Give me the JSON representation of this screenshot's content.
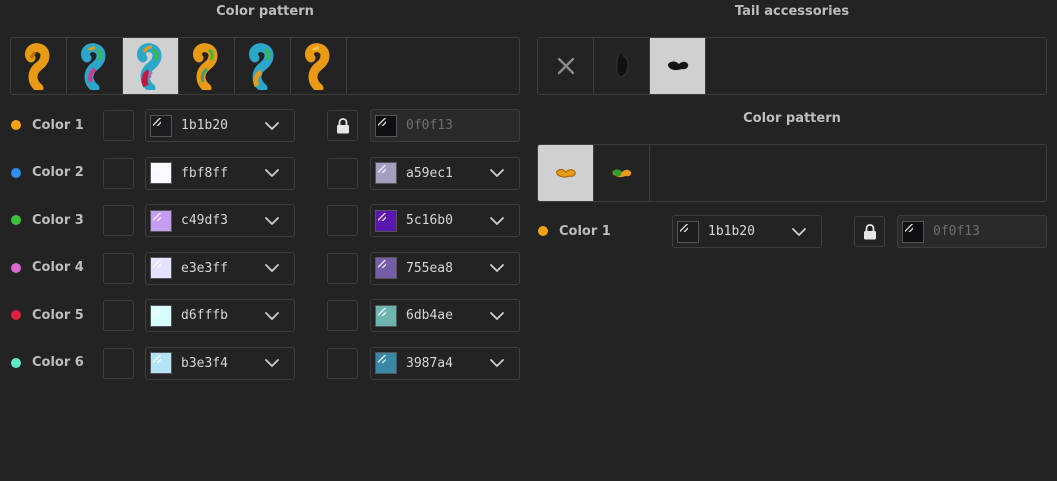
{
  "left": {
    "title": "Color pattern",
    "pattern_thumbs": [
      {
        "name": "tail-pattern-1",
        "selected": false
      },
      {
        "name": "tail-pattern-2",
        "selected": false
      },
      {
        "name": "tail-pattern-3",
        "selected": true
      },
      {
        "name": "tail-pattern-4",
        "selected": false
      },
      {
        "name": "tail-pattern-5",
        "selected": false
      },
      {
        "name": "tail-pattern-6",
        "selected": false
      }
    ],
    "rows": [
      {
        "label": "Color 1",
        "dot": "#f5a30f",
        "primary_hex": "1b1b20",
        "primary_color": "#1b1b20",
        "secondary_hex": "0f0f13",
        "secondary_color": "#0f0f13",
        "locked": true
      },
      {
        "label": "Color 2",
        "dot": "#2f8ff0",
        "primary_hex": "fbf8ff",
        "primary_color": "#fbf8ff",
        "secondary_hex": "a59ec1",
        "secondary_color": "#a59ec1",
        "locked": false
      },
      {
        "label": "Color 3",
        "dot": "#3bc43b",
        "primary_hex": "c49df3",
        "primary_color": "#c49df3",
        "secondary_hex": "5c16b0",
        "secondary_color": "#5c16b0",
        "locked": false
      },
      {
        "label": "Color 4",
        "dot": "#d86ad0",
        "primary_hex": "e3e3ff",
        "primary_color": "#e3e3ff",
        "secondary_hex": "755ea8",
        "secondary_color": "#755ea8",
        "locked": false
      },
      {
        "label": "Color 5",
        "dot": "#e0203c",
        "primary_hex": "d6fffb",
        "primary_color": "#d6fffb",
        "secondary_hex": "6db4ae",
        "secondary_color": "#6db4ae",
        "locked": false
      },
      {
        "label": "Color 6",
        "dot": "#5fe8c8",
        "primary_hex": "b3e3f4",
        "primary_color": "#b3e3f4",
        "secondary_hex": "3987a4",
        "secondary_color": "#3987a4",
        "locked": false
      }
    ]
  },
  "right": {
    "title": "Tail accessories",
    "accessories": [
      {
        "name": "none-icon",
        "selected": false
      },
      {
        "name": "accessory-dark-blob",
        "selected": false
      },
      {
        "name": "accessory-black-bow",
        "selected": true
      }
    ],
    "pattern_title": "Color pattern",
    "patterns": [
      {
        "name": "accessory-pattern-1",
        "selected": true
      },
      {
        "name": "accessory-pattern-2",
        "selected": false
      }
    ],
    "rows": [
      {
        "label": "Color 1",
        "dot": "#f5a30f",
        "primary_hex": "1b1b20",
        "primary_color": "#1b1b20",
        "secondary_hex": "0f0f13",
        "secondary_color": "#0f0f13",
        "locked": true
      }
    ]
  }
}
